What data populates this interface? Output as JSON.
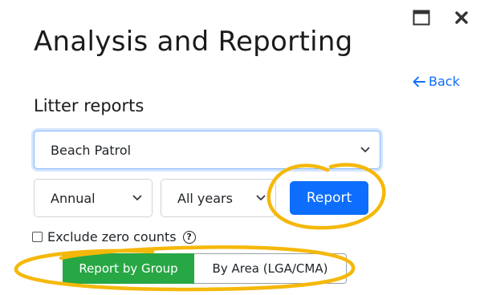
{
  "window": {
    "maximize_icon": "maximize-icon",
    "close_icon": "close-icon"
  },
  "header": {
    "title": "Analysis and Reporting",
    "back_label": "Back",
    "back_icon": "arrow-left-icon"
  },
  "section": {
    "title": "Litter reports"
  },
  "filters": {
    "report_type": {
      "value": "Beach Patrol"
    },
    "period": {
      "value": "Annual"
    },
    "years": {
      "value": "All years"
    }
  },
  "actions": {
    "report_label": "Report"
  },
  "options": {
    "exclude_zero_label": "Exclude zero counts",
    "exclude_zero_checked": false,
    "help_icon": "question-circle-icon"
  },
  "grouping": {
    "by_group_label": "Report by Group",
    "by_area_label": "By Area (LGA/CMA)",
    "selected": "by_group"
  },
  "colors": {
    "accent_blue": "#0d6efd",
    "group_green": "#28a745",
    "highlight_yellow": "#f5b80a"
  }
}
